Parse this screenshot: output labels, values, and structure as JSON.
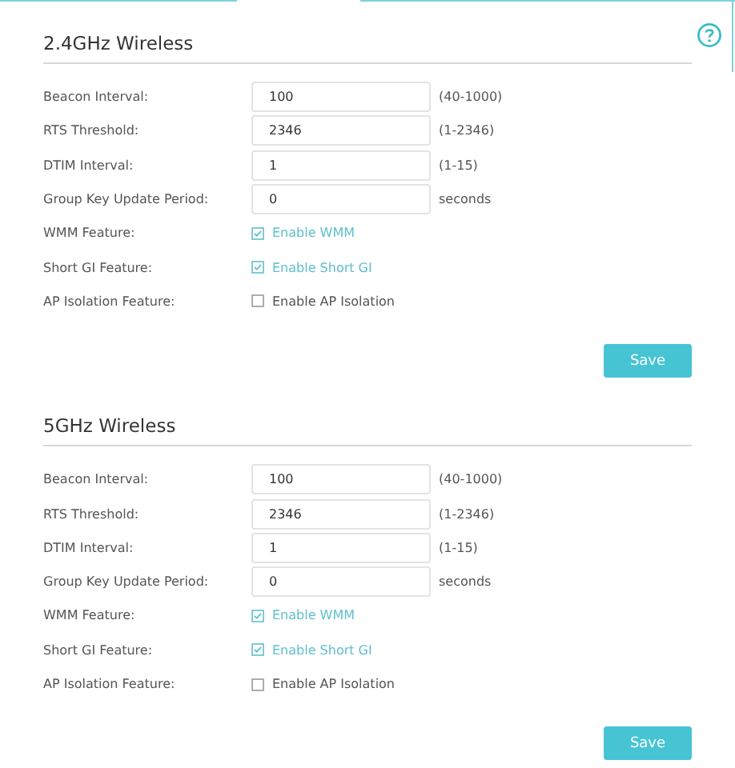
{
  "sections": [
    {
      "title": "2.4GHz Wireless",
      "rows": [
        {
          "kind": "input",
          "label": "Beacon Interval:",
          "value": "100",
          "hint": "(40-1000)"
        },
        {
          "kind": "input",
          "label": "RTS Threshold:",
          "value": "2346",
          "hint": "(1-2346)"
        },
        {
          "kind": "input",
          "label": "DTIM Interval:",
          "value": "1",
          "hint": "(1-15)"
        },
        {
          "kind": "input",
          "label": "Group Key Update Period:",
          "value": "0",
          "hint": "seconds"
        },
        {
          "kind": "checkbox",
          "label": "WMM Feature:",
          "option": "Enable WMM",
          "checked": true
        },
        {
          "kind": "checkbox",
          "label": "Short GI Feature:",
          "option": "Enable Short GI",
          "checked": true
        },
        {
          "kind": "checkbox",
          "label": "AP Isolation Feature:",
          "option": "Enable AP Isolation",
          "checked": false
        }
      ],
      "button": "Save"
    },
    {
      "title": "5GHz Wireless",
      "rows": [
        {
          "kind": "input",
          "label": "Beacon Interval:",
          "value": "100",
          "hint": "(40-1000)"
        },
        {
          "kind": "input",
          "label": "RTS Threshold:",
          "value": "2346",
          "hint": "(1-2346)"
        },
        {
          "kind": "input",
          "label": "DTIM Interval:",
          "value": "1",
          "hint": "(1-15)"
        },
        {
          "kind": "input",
          "label": "Group Key Update Period:",
          "value": "0",
          "hint": "seconds"
        },
        {
          "kind": "checkbox",
          "label": "WMM Feature:",
          "option": "Enable WMM",
          "checked": true
        },
        {
          "kind": "checkbox",
          "label": "Short GI Feature:",
          "option": "Enable Short GI",
          "checked": true
        },
        {
          "kind": "checkbox",
          "label": "AP Isolation Feature:",
          "option": "Enable AP Isolation",
          "checked": false
        }
      ],
      "button": "Save"
    }
  ]
}
